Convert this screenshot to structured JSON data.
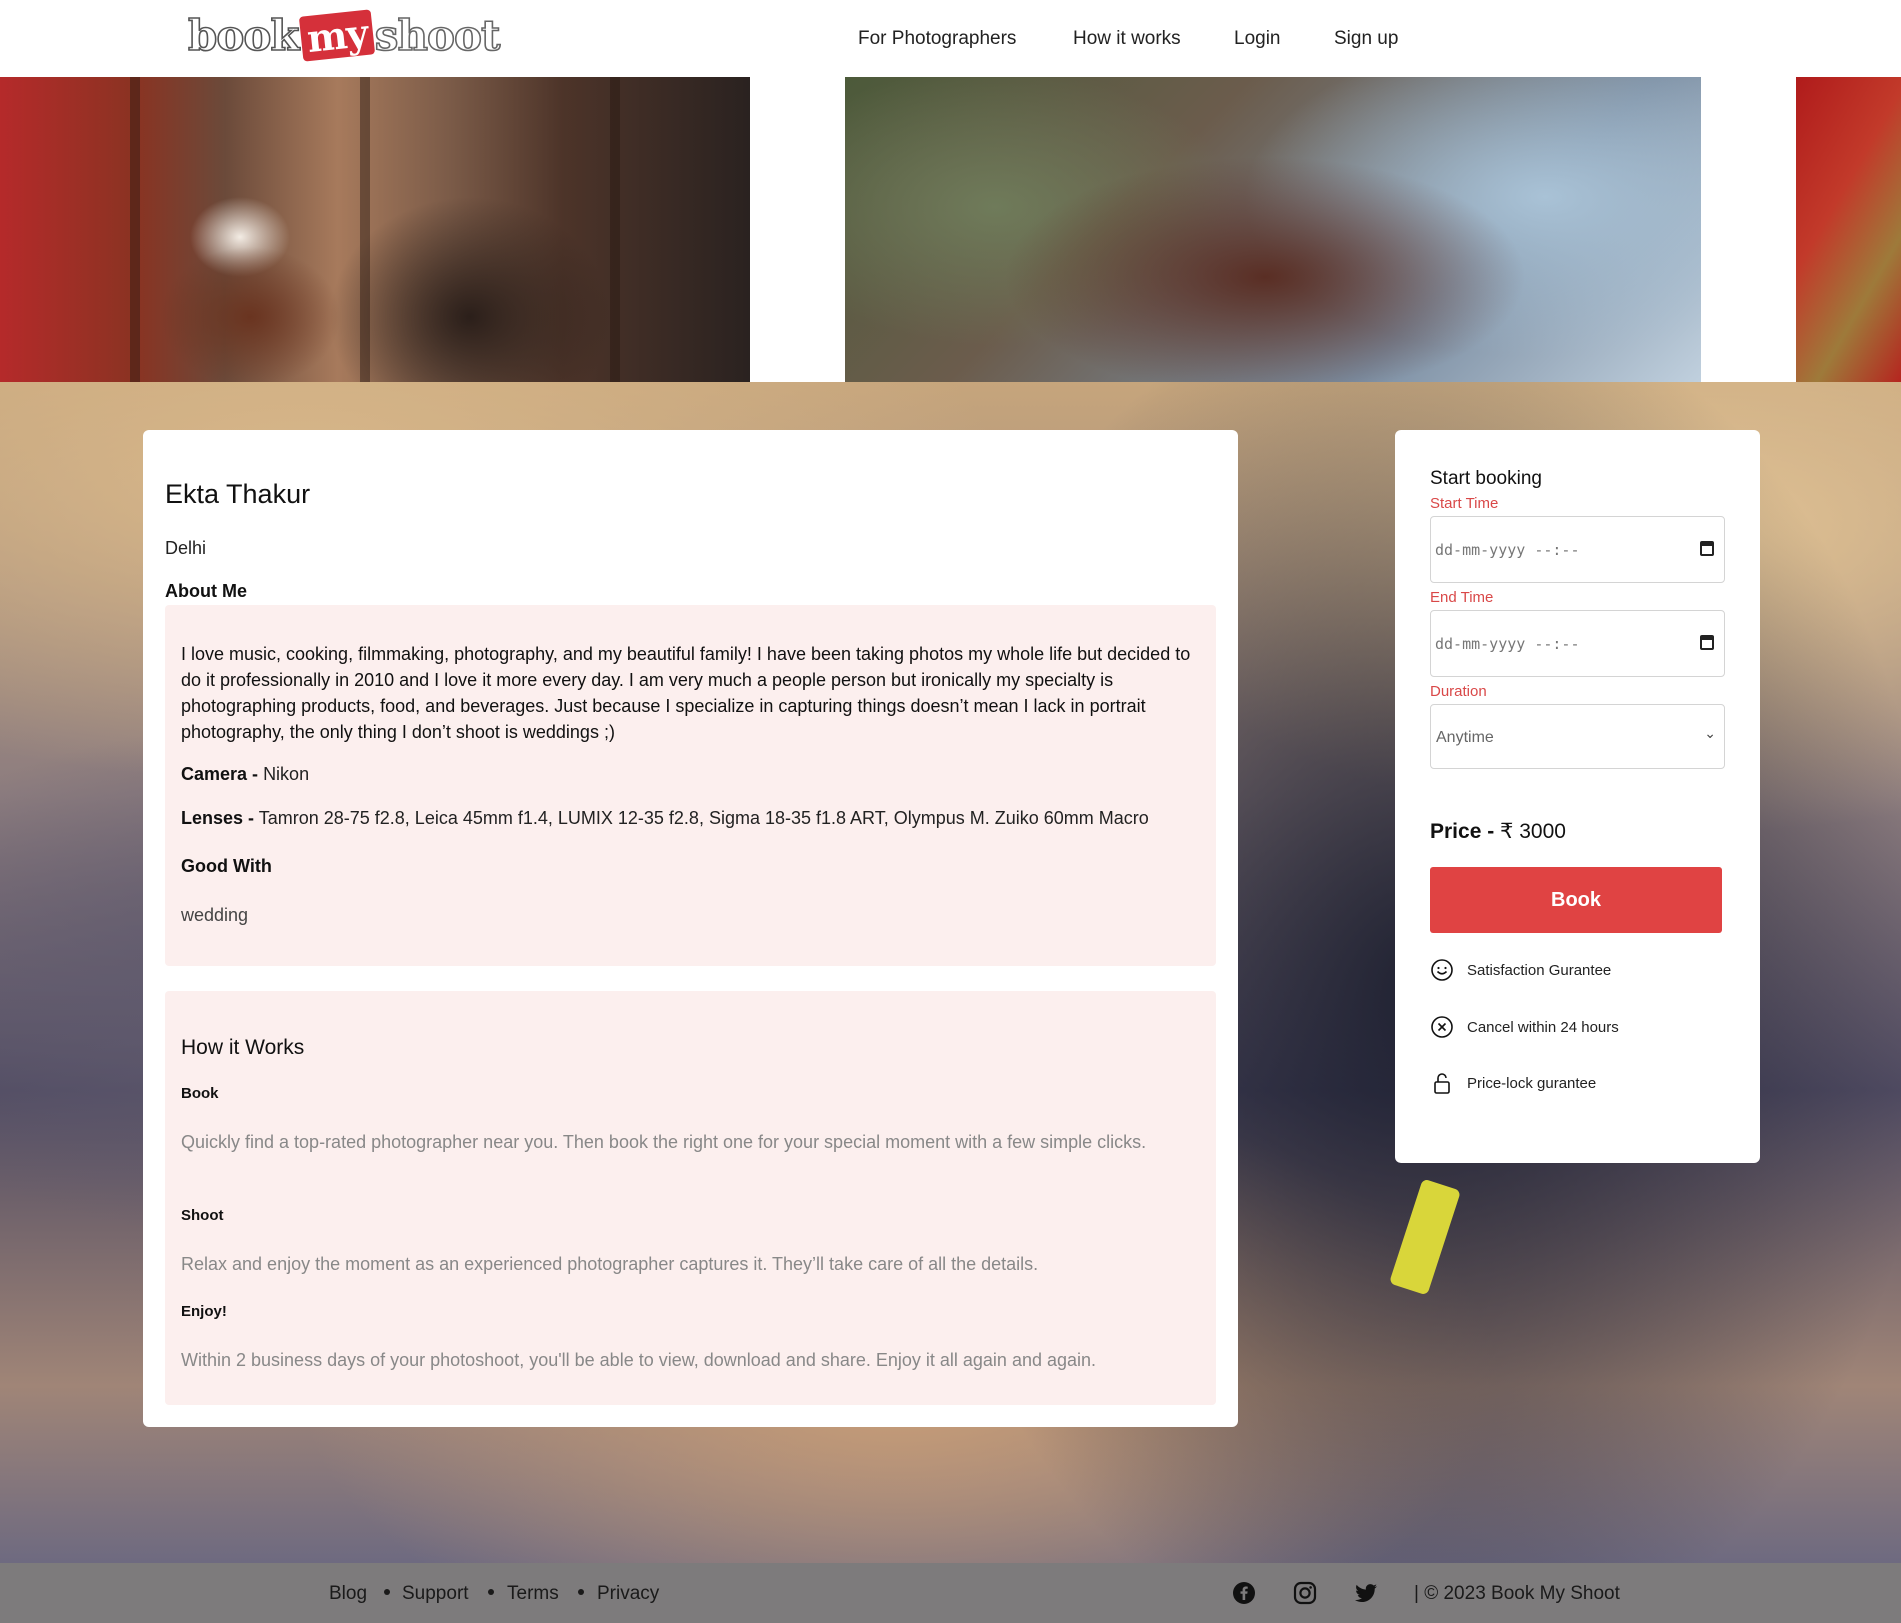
{
  "header": {
    "logo": {
      "part1": "book",
      "part2": "my",
      "part3": "shoot"
    },
    "nav": [
      "For Photographers",
      "How it works",
      "Login",
      "Sign up"
    ]
  },
  "profile": {
    "name": "Ekta Thakur",
    "city": "Delhi",
    "about_heading": "About Me",
    "about_text": "I love music, cooking, filmmaking, photography, and my beautiful family! I have been taking photos my whole life but decided to do it professionally in 2010 and I love it more every day. I am very much a people person but ironically my specialty is photographing products, food, and beverages. Just because I specialize in capturing things doesn’t mean I lack in portrait photography, the only thing I don’t shoot is weddings ;)",
    "camera_label": "Camera -",
    "camera_value": "Nikon",
    "lenses_label": "Lenses -",
    "lenses_value": "Tamron 28-75 f2.8, Leica 45mm f1.4, LUMIX 12-35 f2.8, Sigma 18-35 f1.8 ART, Olympus M. Zuiko 60mm Macro",
    "good_with_heading": "Good With",
    "good_with_value": "wedding"
  },
  "how_it_works": {
    "title": "How it Works",
    "steps": [
      {
        "heading": "Book",
        "text": "Quickly find a top-rated photographer near you. Then book the right one for your special moment with a few simple clicks."
      },
      {
        "heading": "Shoot",
        "text": "Relax and enjoy the moment as an experienced photographer captures it. They’ll take care of all the details."
      },
      {
        "heading": "Enjoy!",
        "text": "Within 2 business days of your photoshoot, you'll be able to view, download and share. Enjoy it all again and again."
      }
    ]
  },
  "booking": {
    "title": "Start booking",
    "start_label": "Start Time",
    "start_placeholder": "dd-mm-yyyy --:--",
    "end_label": "End Time",
    "end_placeholder": "dd-mm-yyyy --:--",
    "duration_label": "Duration",
    "duration_value": "Anytime",
    "price_label": "Price -",
    "price_value": "₹ 3000",
    "book_button": "Book",
    "features": [
      "Satisfaction Gurantee",
      "Cancel within 24 hours",
      "Price-lock gurantee"
    ]
  },
  "footer": {
    "links": [
      "Blog",
      "Support",
      "Terms",
      "Privacy"
    ],
    "social": [
      "facebook-icon",
      "instagram-icon",
      "twitter-icon"
    ],
    "copyright": "| © 2023 Book My Shoot"
  },
  "colors": {
    "accent": "#e04343",
    "label_red": "#d94848",
    "pink_panel": "#fcefee",
    "footer": "#7d7b7c"
  }
}
